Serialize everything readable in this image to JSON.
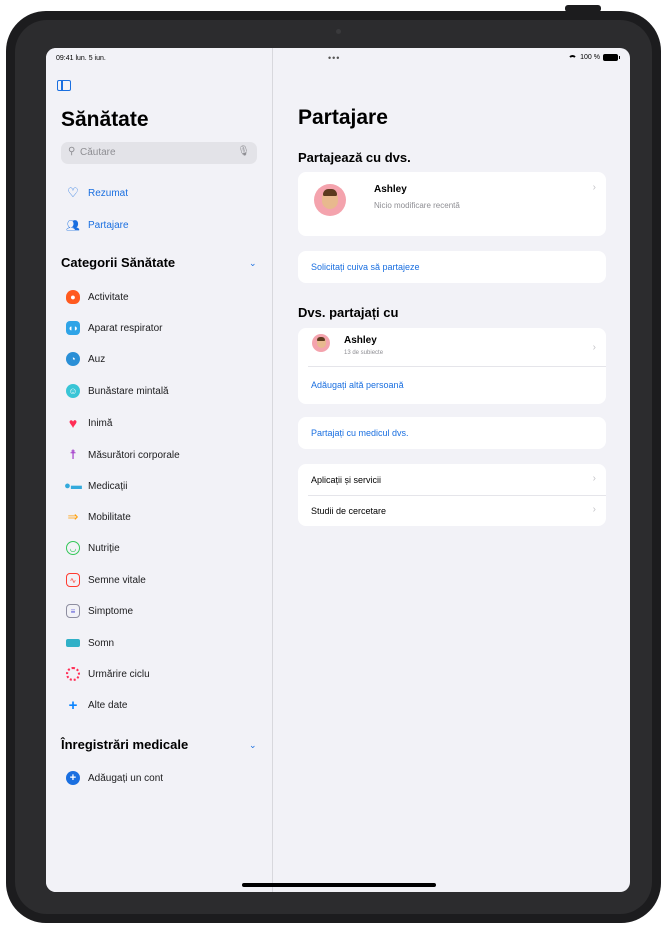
{
  "status": {
    "time": "09:41  lun. 5 iun.",
    "battery": "100 %"
  },
  "sidebar": {
    "title": "Sănătate",
    "search_placeholder": "Căutare",
    "top_items": [
      {
        "label": "Rezumat",
        "icon": "heart-outline-icon"
      },
      {
        "label": "Partajare",
        "icon": "people-icon"
      }
    ],
    "categories_header": "Categorii Sănătate",
    "categories": [
      {
        "label": "Activitate",
        "icon": "flame-icon",
        "color": "#ff5a1f"
      },
      {
        "label": "Aparat respirator",
        "icon": "lungs-icon",
        "color": "#2fa4e7"
      },
      {
        "label": "Auz",
        "icon": "ear-icon",
        "color": "#2a8fd6"
      },
      {
        "label": "Bunăstare mintală",
        "icon": "mind-icon",
        "color": "#39c5d6"
      },
      {
        "label": "Inimă",
        "icon": "heart-icon",
        "color": "#ff2d55"
      },
      {
        "label": "Măsurători corporale",
        "icon": "figure-icon",
        "color": "#a239ca"
      },
      {
        "label": "Medicații",
        "icon": "pills-icon",
        "color": "#34aadc"
      },
      {
        "label": "Mobilitate",
        "icon": "arrows-icon",
        "color": "#ff9f0a"
      },
      {
        "label": "Nutriție",
        "icon": "apple-icon",
        "color": "#34c759"
      },
      {
        "label": "Semne vitale",
        "icon": "waveform-icon",
        "color": "#ff3b30"
      },
      {
        "label": "Simptome",
        "icon": "list-icon",
        "color": "#5856d6"
      },
      {
        "label": "Somn",
        "icon": "bed-icon",
        "color": "#30b0c7"
      },
      {
        "label": "Urmărire ciclu",
        "icon": "dots-circle-icon",
        "color": "#ff2d55"
      },
      {
        "label": "Alte date",
        "icon": "plus-icon",
        "color": "#0a84ff"
      }
    ],
    "records_header": "Înregistrări medicale",
    "add_account": "Adăugați un cont"
  },
  "main": {
    "title": "Partajare",
    "shared_with_you": {
      "header": "Partajează cu dvs.",
      "person": "Ashley",
      "subtitle": "Nicio modificare recentă",
      "request_link": "Solicitați cuiva să partajeze"
    },
    "you_share_with": {
      "header": "Dvs. partajați cu",
      "person": "Ashley",
      "subtitle": "13 de subiecte",
      "add_link": "Adăugați altă persoană"
    },
    "share_doctor": "Partajați cu medicul dvs.",
    "apps_services": "Aplicații și servicii",
    "research": "Studii de cercetare"
  }
}
